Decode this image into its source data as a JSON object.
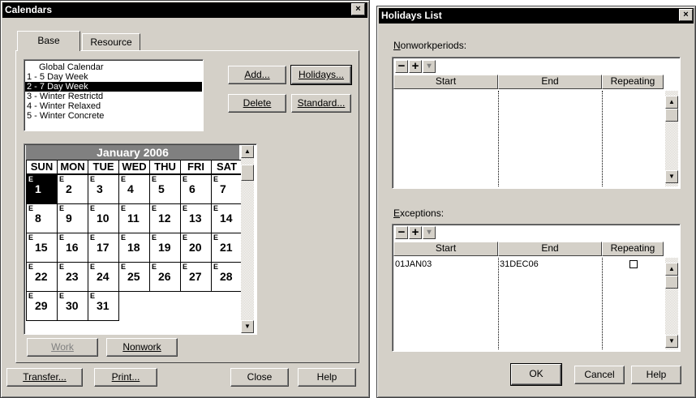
{
  "calendars": {
    "title": "Calendars",
    "close": "×",
    "tabs": [
      "Base",
      "Resource"
    ],
    "list": [
      "Global Calendar",
      "1 - 5 Day Week",
      "2 - 7 Day Week",
      "3 - Winter Restrictd",
      "4 - Winter Relaxed",
      "5 - Winter Concrete"
    ],
    "selected_index": 2,
    "buttons": {
      "add": "Add...",
      "holidays": "Holidays...",
      "delete": "Delete",
      "standard": "Standard...",
      "work": "Work",
      "nonwork": "Nonwork",
      "transfer": "Transfer...",
      "print": "Print...",
      "close": "Close",
      "help": "Help"
    },
    "month": "January  2006",
    "days": [
      "SUN",
      "MON",
      "TUE",
      "WED",
      "THU",
      "FRI",
      "SAT"
    ],
    "day_marker": "E",
    "dates": [
      "1",
      "2",
      "3",
      "4",
      "5",
      "6",
      "7",
      "8",
      "9",
      "10",
      "11",
      "12",
      "13",
      "14",
      "15",
      "16",
      "17",
      "18",
      "19",
      "20",
      "21",
      "22",
      "23",
      "24",
      "25",
      "26",
      "27",
      "28",
      "29",
      "30",
      "31"
    ],
    "selected_date": "1"
  },
  "holidays": {
    "title": "Holidays List",
    "close": "×",
    "nonwork_label": "Nonworkperiods:",
    "exceptions_label": "Exceptions:",
    "toolbar": [
      "−",
      "+",
      "▾"
    ],
    "columns": [
      "Start",
      "End",
      "Repeating"
    ],
    "nonwork_rows": [],
    "exception_rows": [
      {
        "start": "01JAN03",
        "end": "31DEC06",
        "repeating": false
      }
    ],
    "buttons": {
      "ok": "OK",
      "cancel": "Cancel",
      "help": "Help"
    }
  }
}
